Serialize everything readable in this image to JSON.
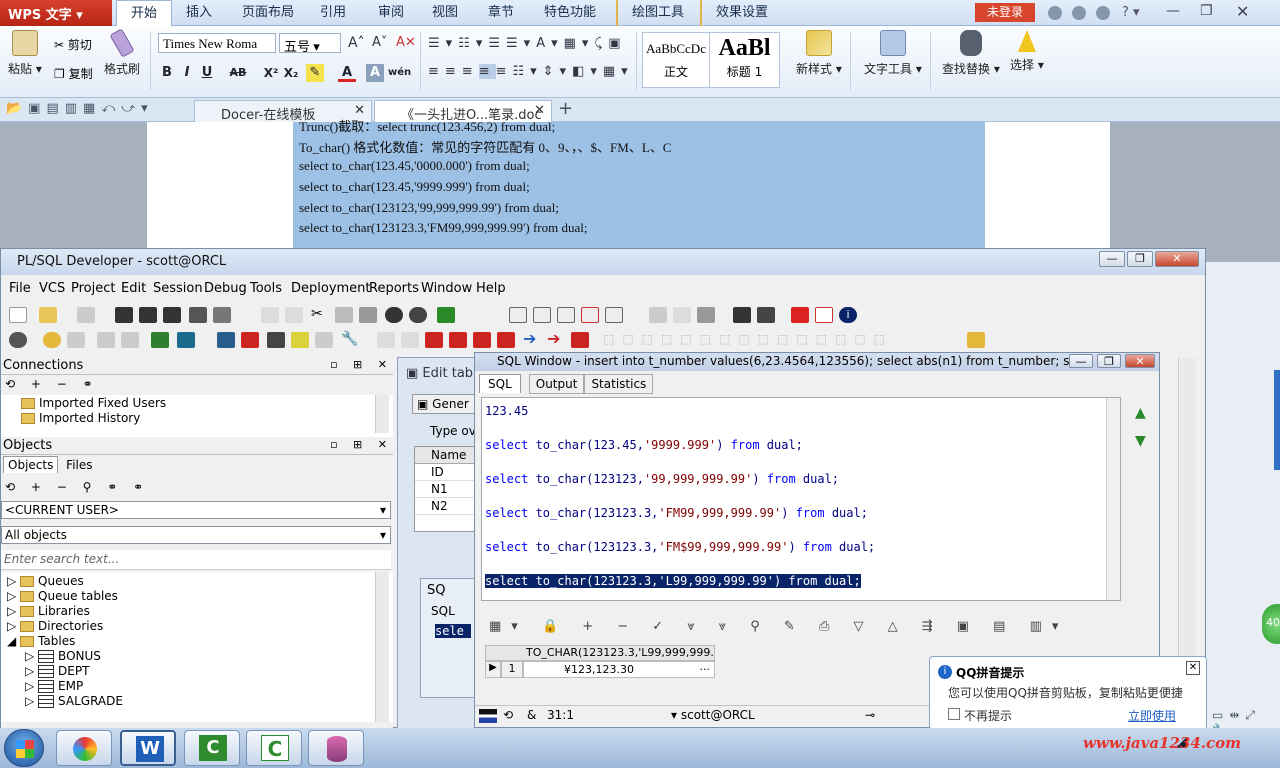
{
  "wps": {
    "logo": "WPS 文字",
    "tabs": [
      "开始",
      "插入",
      "页面布局",
      "引用",
      "审阅",
      "视图",
      "章节",
      "特色功能",
      "绘图工具",
      "效果设置"
    ],
    "login": "未登录",
    "ribbon": {
      "paste": "粘贴",
      "cut": "剪切",
      "copy": "复制",
      "format_painter": "格式刷",
      "font": "Times New Roma",
      "size": "五号",
      "style_normal_preview": "AaBbCcDc",
      "style_normal": "正文",
      "style_h1_preview": "AaBl",
      "style_h1": "标题 1",
      "new_style": "新样式",
      "text_tools": "文字工具",
      "find_replace": "查找替换",
      "select": "选择"
    },
    "doc_tabs": [
      "Docer-在线模板",
      "《一头扎进O...笔录.doc"
    ],
    "doc_lines": [
      "Trunc()截取：select trunc(123.456,2) from dual;",
      "To_char() 格式化数值：常见的字符匹配有   0、9、，、$、FM、L、C",
      "select to_char(123.45,'0000.000') from dual;",
      "select to_char(123.45,'9999.999') from dual;",
      "select to_char(123123,'99,999,999.99') from dual;",
      "select to_char(123123.3,'FM99,999,999.99') from dual;"
    ]
  },
  "plsql": {
    "title": "PL/SQL Developer - scott@ORCL",
    "menu": [
      "File",
      "VCS",
      "Project",
      "Edit",
      "Session",
      "Debug",
      "Tools",
      "Deployment",
      "Reports",
      "Window",
      "Help"
    ],
    "connections": {
      "header": "Connections",
      "items": [
        "Imported Fixed Users",
        "Imported History"
      ]
    },
    "objects": {
      "header": "Objects",
      "tabs": [
        "Objects",
        "Files"
      ],
      "user_select": "<CURRENT USER>",
      "filter_select": "All objects",
      "search_placeholder": "Enter search text...",
      "tree": [
        "Queues",
        "Queue tables",
        "Libraries",
        "Directories",
        "Tables"
      ],
      "tables": [
        "BONUS",
        "DEPT",
        "EMP",
        "SALGRADE"
      ]
    },
    "edit_table": {
      "title": "Edit tab",
      "tab": "Gener",
      "type_label": "Type ov",
      "col_header": "Name",
      "rows": [
        "ID",
        "N1",
        "N2"
      ]
    },
    "sql_mini": {
      "title": "SQ",
      "tab": "SQL",
      "text": "sele"
    },
    "sql_window": {
      "title": "SQL Window - insert into t_number values(6,23.4564,123556); select abs(n1) from t_number; sel...",
      "tabs": [
        "SQL",
        "Output",
        "Statistics"
      ],
      "code_top": "123.45",
      "queries": [
        {
          "pre": "select ",
          "fn": "to_char(123.45,",
          "arg": "'9999.999'",
          "post": ") ",
          "kw": "from",
          "tail": " dual;"
        },
        {
          "pre": "select ",
          "fn": "to_char(123123,",
          "arg": "'99,999,999.99'",
          "post": ") ",
          "kw": "from",
          "tail": " dual;"
        },
        {
          "pre": "select ",
          "fn": "to_char(123123.3,",
          "arg": "'FM99,999,999.99'",
          "post": ") ",
          "kw": "from",
          "tail": " dual;"
        },
        {
          "pre": "select ",
          "fn": "to_char(123123.3,",
          "arg": "'FM$99,999,999.99'",
          "post": ") ",
          "kw": "from",
          "tail": " dual;"
        }
      ],
      "selected_query": "select to_char(123123.3,'L99,999,999.99') from dual;",
      "result_header": "TO_CHAR(123123.3,'L99,999,999.",
      "result_row_num": "1",
      "result_value": "¥123,123.30",
      "status_pos": "31:1",
      "status_conn": "scott@ORCL"
    }
  },
  "qq": {
    "title": "QQ拼音提示",
    "text": "您可以使用QQ拼音剪贴板，复制粘贴更便捷",
    "checkbox": "不再提示",
    "link": "立即使用"
  },
  "watermark": "www.java1234.com",
  "side_badge": "40"
}
